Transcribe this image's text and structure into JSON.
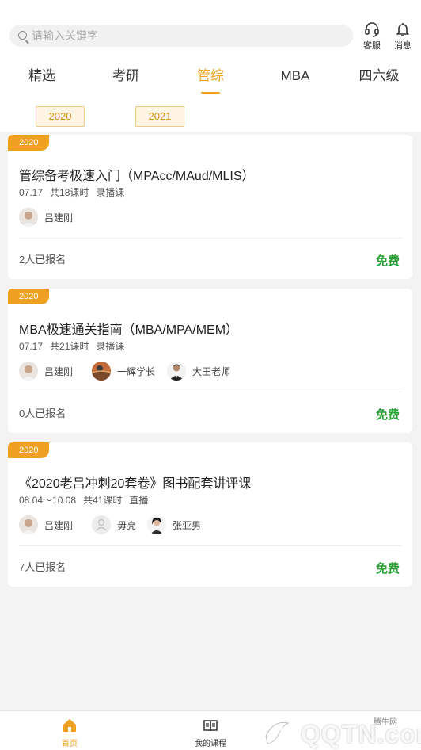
{
  "search": {
    "placeholder": "请输入关键字"
  },
  "header": {
    "service_label": "客服",
    "message_label": "消息"
  },
  "tabs": [
    {
      "label": "精选"
    },
    {
      "label": "考研"
    },
    {
      "label": "管综",
      "active": true
    },
    {
      "label": "MBA"
    },
    {
      "label": "四六级"
    }
  ],
  "years": [
    {
      "label": "2020"
    },
    {
      "label": "2021"
    }
  ],
  "courses": [
    {
      "badge": "2020",
      "title": "管综备考极速入门（MPAcc/MAud/MLIS）",
      "date": "07.17",
      "lessons": "共18课时",
      "type": "录播课",
      "teachers": [
        {
          "name": "吕建刚"
        }
      ],
      "enrolled": "2人已报名",
      "price": "免费"
    },
    {
      "badge": "2020",
      "title": "MBA极速通关指南（MBA/MPA/MEM）",
      "date": "07.17",
      "lessons": "共21课时",
      "type": "录播课",
      "teachers": [
        {
          "name": "吕建刚"
        },
        {
          "name": "一辉学长"
        },
        {
          "name": "大王老师"
        }
      ],
      "enrolled": "0人已报名",
      "price": "免费"
    },
    {
      "badge": "2020",
      "title": "《2020老吕冲刺20套卷》图书配套讲评课",
      "date": "08.04～10.08",
      "lessons": "共41课时",
      "type": "直播",
      "teachers": [
        {
          "name": "吕建刚"
        },
        {
          "name": "毋亮"
        },
        {
          "name": "张亚男"
        }
      ],
      "enrolled": "7人已报名",
      "price": "免费"
    }
  ],
  "bottom_nav": [
    {
      "label": "首页",
      "active": true
    },
    {
      "label": "我的课程"
    }
  ],
  "watermark": {
    "text": "QQTN.com",
    "sub": "腾牛网"
  },
  "colors": {
    "accent": "#f0a020",
    "free": "#2aa036",
    "year_bg": "#fdf4e4"
  }
}
